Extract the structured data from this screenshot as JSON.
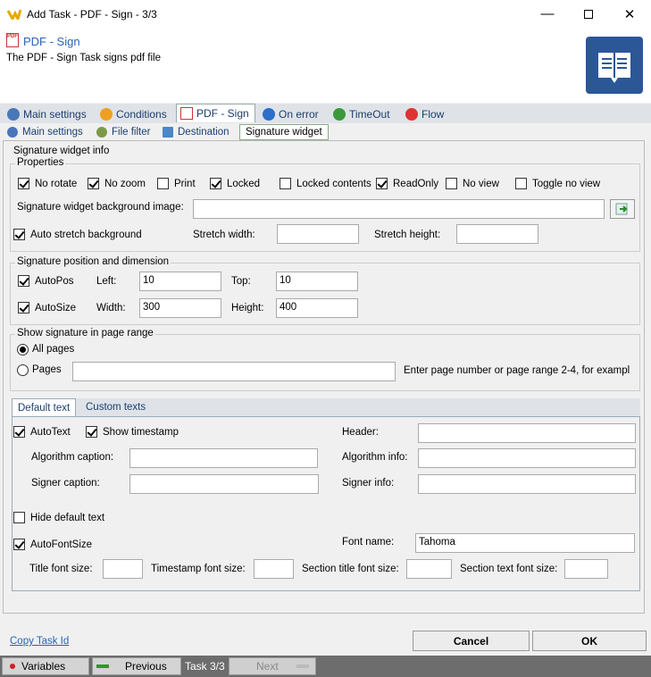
{
  "window": {
    "title": "Add Task - PDF - Sign - 3/3"
  },
  "header": {
    "task_name": "PDF - Sign",
    "description": "The PDF - Sign Task signs pdf file"
  },
  "main_tabs": [
    {
      "label": "Main settings"
    },
    {
      "label": "Conditions"
    },
    {
      "label": "PDF - Sign"
    },
    {
      "label": "On error"
    },
    {
      "label": "TimeOut"
    },
    {
      "label": "Flow"
    }
  ],
  "sub_tabs": [
    {
      "label": "Main settings"
    },
    {
      "label": "File filter"
    },
    {
      "label": "Destination"
    },
    {
      "label": "Signature widget"
    }
  ],
  "section_title": "Signature widget info",
  "properties": {
    "title": "Properties",
    "no_rotate": "No rotate",
    "no_zoom": "No zoom",
    "print": "Print",
    "locked": "Locked",
    "locked_contents": "Locked contents",
    "readonly": "ReadOnly",
    "no_view": "No view",
    "toggle_no_view": "Toggle no view",
    "bg_image_label": "Signature widget background image:",
    "auto_stretch": "Auto stretch background",
    "stretch_width": "Stretch width:",
    "stretch_height": "Stretch height:"
  },
  "position": {
    "title": "Signature position and dimension",
    "autopos": "AutoPos",
    "left_label": "Left:",
    "left_value": "10",
    "top_label": "Top:",
    "top_value": "10",
    "autosize": "AutoSize",
    "width_label": "Width:",
    "width_value": "300",
    "height_label": "Height:",
    "height_value": "400"
  },
  "page_range": {
    "title": "Show signature in page range",
    "all_pages": "All pages",
    "pages": "Pages",
    "hint": "Enter page number or page range 2-4, for exampl"
  },
  "text_tabs": [
    {
      "label": "Default text"
    },
    {
      "label": "Custom texts"
    }
  ],
  "default_text": {
    "autotext": "AutoText",
    "show_timestamp": "Show timestamp",
    "header": "Header:",
    "algorithm_caption": "Algorithm caption:",
    "algorithm_info": "Algorithm info:",
    "signer_caption": "Signer caption:",
    "signer_info": "Signer info:",
    "hide_default_text": "Hide default text",
    "autofontsize": "AutoFontSize",
    "font_name_label": "Font name:",
    "font_name_value": "Tahoma",
    "title_font_size": "Title font size:",
    "timestamp_font_size": "Timestamp font size:",
    "section_title_font_size": "Section title font size:",
    "section_text_font_size": "Section text font size:"
  },
  "footer": {
    "copy_link": "Copy Task Id",
    "cancel": "Cancel",
    "ok": "OK"
  },
  "bottom": {
    "variables": "Variables",
    "previous": "Previous",
    "task_counter": "Task 3/3",
    "next": "Next"
  },
  "colors": {
    "accent": "#2b5797",
    "link": "#2a62b5"
  }
}
